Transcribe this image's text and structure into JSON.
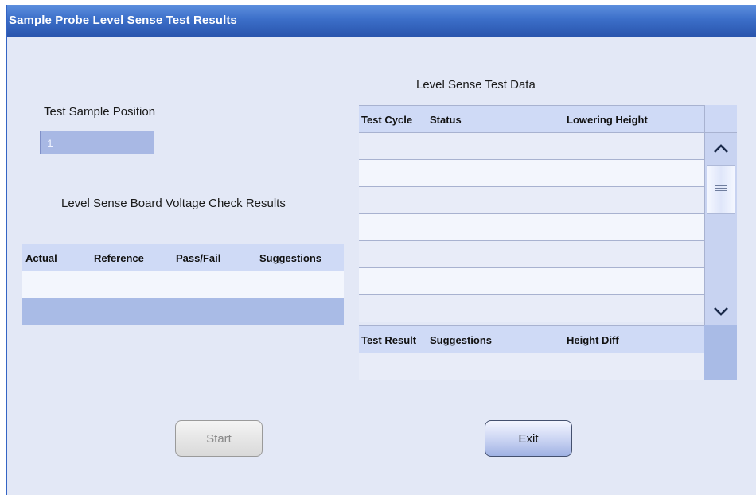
{
  "window": {
    "title": "Sample Probe Level Sense Test Results"
  },
  "sample_position": {
    "label": "Test Sample Position",
    "value": "1"
  },
  "voltage_check": {
    "title": "Level Sense Board Voltage Check Results",
    "columns": [
      "Actual",
      "Reference",
      "Pass/Fail",
      "Suggestions"
    ]
  },
  "level_sense": {
    "title": "Level Sense Test Data",
    "columns": [
      "Test Cycle",
      "Status",
      "Lowering Height"
    ]
  },
  "results": {
    "columns": [
      "Test Result",
      "Suggestions",
      "Height Diff"
    ]
  },
  "buttons": {
    "start": "Start",
    "exit": "Exit"
  },
  "icons": {
    "scroll_up": "chevron-up-icon",
    "scroll_down": "chevron-down-icon",
    "thumb": "grip-icon"
  }
}
